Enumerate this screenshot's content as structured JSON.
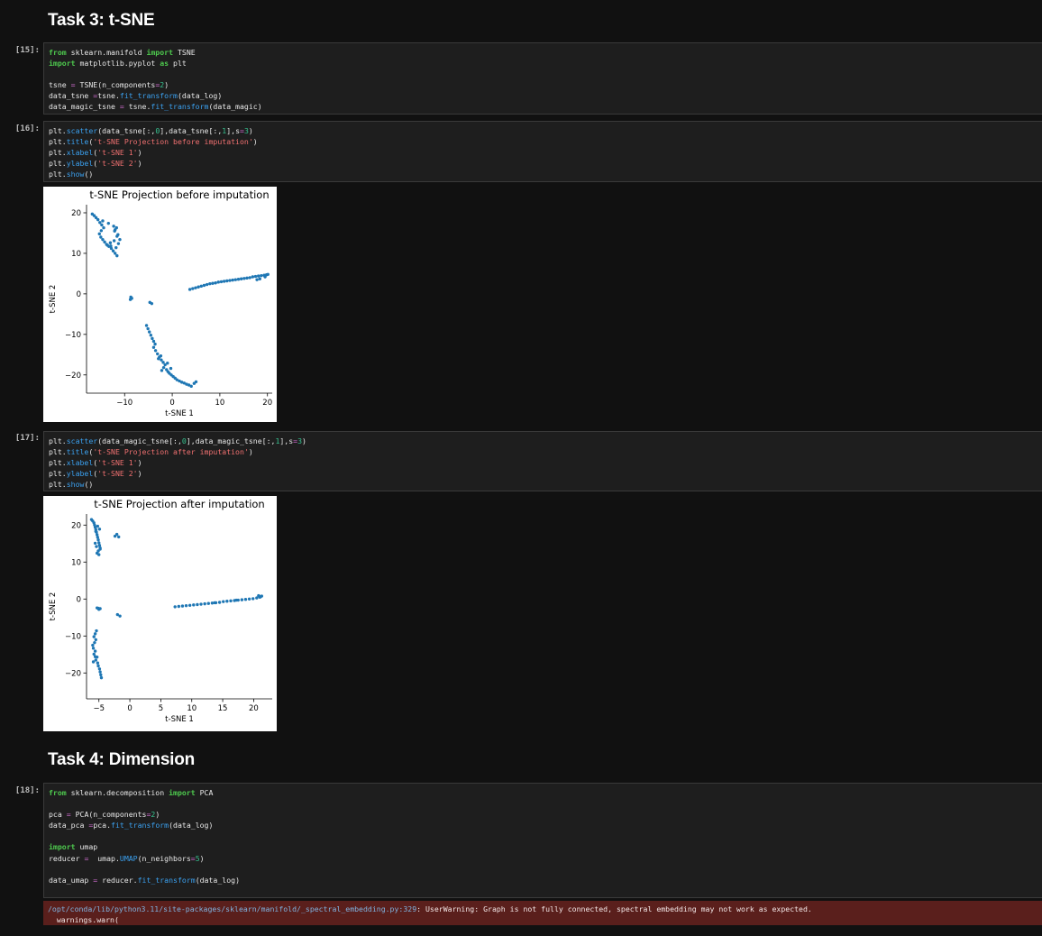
{
  "headings": {
    "task3": "Task 3: t-SNE",
    "task4": "Task 4: Dimension"
  },
  "cells": {
    "c15": {
      "prompt": "[15]:",
      "lines": [
        [
          [
            "kw",
            "from"
          ],
          [
            "t",
            " sklearn.manifold "
          ],
          [
            "kw",
            "import"
          ],
          [
            "t",
            " TSNE"
          ]
        ],
        [
          [
            "kw",
            "import"
          ],
          [
            "t",
            " matplotlib.pyplot "
          ],
          [
            "kw",
            "as"
          ],
          [
            "t",
            " plt"
          ]
        ],
        [],
        [
          [
            "t",
            "tsne "
          ],
          [
            "op",
            "="
          ],
          [
            "t",
            " TSNE(n_components"
          ],
          [
            "op",
            "="
          ],
          [
            "num",
            "2"
          ],
          [
            "t",
            ")"
          ]
        ],
        [
          [
            "t",
            "data_tsne "
          ],
          [
            "op",
            "="
          ],
          [
            "t",
            "tsne."
          ],
          [
            "fn",
            "fit_transform"
          ],
          [
            "t",
            "(data_log)"
          ]
        ],
        [
          [
            "t",
            "data_magic_tsne "
          ],
          [
            "op",
            "="
          ],
          [
            "t",
            " tsne."
          ],
          [
            "fn",
            "fit_transform"
          ],
          [
            "t",
            "(data_magic)"
          ]
        ]
      ]
    },
    "c16": {
      "prompt": "[16]:",
      "lines": [
        [
          [
            "t",
            "plt."
          ],
          [
            "fn",
            "scatter"
          ],
          [
            "t",
            "(data_tsne[:,"
          ],
          [
            "num",
            "0"
          ],
          [
            "t",
            "],data_tsne[:,"
          ],
          [
            "num",
            "1"
          ],
          [
            "t",
            "],s"
          ],
          [
            "op",
            "="
          ],
          [
            "num",
            "3"
          ],
          [
            "t",
            ")"
          ]
        ],
        [
          [
            "t",
            "plt."
          ],
          [
            "fn",
            "title"
          ],
          [
            "t",
            "("
          ],
          [
            "str",
            "'t-SNE Projection before imputation'"
          ],
          [
            "t",
            ")"
          ]
        ],
        [
          [
            "t",
            "plt."
          ],
          [
            "fn",
            "xlabel"
          ],
          [
            "t",
            "("
          ],
          [
            "str",
            "'t-SNE 1'"
          ],
          [
            "t",
            ")"
          ]
        ],
        [
          [
            "t",
            "plt."
          ],
          [
            "fn",
            "ylabel"
          ],
          [
            "t",
            "("
          ],
          [
            "str",
            "'t-SNE 2'"
          ],
          [
            "t",
            ")"
          ]
        ],
        [
          [
            "t",
            "plt."
          ],
          [
            "fn",
            "show"
          ],
          [
            "t",
            "()"
          ]
        ]
      ]
    },
    "c17": {
      "prompt": "[17]:",
      "lines": [
        [
          [
            "t",
            "plt."
          ],
          [
            "fn",
            "scatter"
          ],
          [
            "t",
            "(data_magic_tsne[:,"
          ],
          [
            "num",
            "0"
          ],
          [
            "t",
            "],data_magic_tsne[:,"
          ],
          [
            "num",
            "1"
          ],
          [
            "t",
            "],s"
          ],
          [
            "op",
            "="
          ],
          [
            "num",
            "3"
          ],
          [
            "t",
            ")"
          ]
        ],
        [
          [
            "t",
            "plt."
          ],
          [
            "fn",
            "title"
          ],
          [
            "t",
            "("
          ],
          [
            "str",
            "'t-SNE Projection after imputation'"
          ],
          [
            "t",
            ")"
          ]
        ],
        [
          [
            "t",
            "plt."
          ],
          [
            "fn",
            "xlabel"
          ],
          [
            "t",
            "("
          ],
          [
            "str",
            "'t-SNE 1'"
          ],
          [
            "t",
            ")"
          ]
        ],
        [
          [
            "t",
            "plt."
          ],
          [
            "fn",
            "ylabel"
          ],
          [
            "t",
            "("
          ],
          [
            "str",
            "'t-SNE 2'"
          ],
          [
            "t",
            ")"
          ]
        ],
        [
          [
            "t",
            "plt."
          ],
          [
            "fn",
            "show"
          ],
          [
            "t",
            "()"
          ]
        ]
      ]
    },
    "c18": {
      "prompt": "[18]:",
      "lines": [
        [
          [
            "kw",
            "from"
          ],
          [
            "t",
            " sklearn.decomposition "
          ],
          [
            "kw",
            "import"
          ],
          [
            "t",
            " PCA"
          ]
        ],
        [],
        [
          [
            "t",
            "pca "
          ],
          [
            "op",
            "="
          ],
          [
            "t",
            " PCA(n_components"
          ],
          [
            "op",
            "="
          ],
          [
            "num",
            "2"
          ],
          [
            "t",
            ")"
          ]
        ],
        [
          [
            "t",
            "data_pca "
          ],
          [
            "op",
            "="
          ],
          [
            "t",
            "pca."
          ],
          [
            "fn",
            "fit_transform"
          ],
          [
            "t",
            "(data_log)"
          ]
        ],
        [],
        [
          [
            "kw",
            "import"
          ],
          [
            "t",
            " umap"
          ]
        ],
        [
          [
            "t",
            "reducer "
          ],
          [
            "op",
            "="
          ],
          [
            "t",
            "  umap."
          ],
          [
            "fn",
            "UMAP"
          ],
          [
            "t",
            "(n_neighbors"
          ],
          [
            "op",
            "="
          ],
          [
            "num",
            "5"
          ],
          [
            "t",
            ")"
          ]
        ],
        [],
        [
          [
            "t",
            "data_umap "
          ],
          [
            "op",
            "="
          ],
          [
            "t",
            " reducer."
          ],
          [
            "fn",
            "fit_transform"
          ],
          [
            "t",
            "(data_log)"
          ]
        ]
      ]
    }
  },
  "stderr": {
    "path": "/opt/conda/lib/python3.11/site-packages/sklearn/manifold/_spectral_embedding.py:329",
    "message": ": UserWarning: Graph is not fully connected, spectral embedding may not work as expected.",
    "line2": "  warnings.warn("
  },
  "chart_data": [
    {
      "type": "scatter",
      "title": "t-SNE Projection before imputation",
      "xlabel": "t-SNE 1",
      "ylabel": "t-SNE 2",
      "xlim": [
        -18,
        21
      ],
      "ylim": [
        -24.5,
        22
      ],
      "xticks": [
        -10,
        0,
        10,
        20
      ],
      "yticks": [
        20,
        10,
        0,
        -10,
        -20
      ],
      "color": "#1f77b4",
      "series": [
        {
          "x": [
            -16.8,
            -16.4,
            -16.0,
            -15.6,
            -15.2,
            -14.8,
            -14.4,
            -14.9,
            -15.3,
            -15.0,
            -14.6,
            -14.2,
            -13.8,
            -13.3,
            -12.8,
            -12.4,
            -12.0,
            -11.6,
            -11.8,
            -11.3,
            -11.0,
            -11.4,
            -12.0,
            -12.3,
            -13.4,
            -14.6,
            -11.7,
            -12.1,
            -11.6,
            -12.2,
            -13.0,
            -13.6,
            -12.9,
            -8.7,
            -8.5,
            -8.8,
            -4.7,
            -4.3,
            3.7,
            4.3,
            4.9,
            5.5,
            6.1,
            6.7,
            7.3,
            7.9,
            8.5,
            9.1,
            9.7,
            10.3,
            10.9,
            11.5,
            12.1,
            12.7,
            13.3,
            13.9,
            14.5,
            15.1,
            15.7,
            16.3,
            16.9,
            17.5,
            18.1,
            18.7,
            19.3,
            19.8,
            20.1,
            19.5,
            18.4,
            17.8,
            -5.4,
            -5.1,
            -4.8,
            -4.5,
            -4.2,
            -3.9,
            -3.6,
            -3.9,
            -3.5,
            -3.1,
            -2.7,
            -2.3,
            -1.9,
            -1.5,
            -1.8,
            -2.2,
            -1.2,
            -0.9,
            -0.6,
            -0.2,
            0.2,
            0.6,
            1.0,
            1.5,
            2.0,
            2.5,
            3.0,
            3.5,
            4.0,
            4.6,
            5.0,
            -2.4,
            -2.9,
            -1.0,
            -0.3
          ],
          "y": [
            19.7,
            19.3,
            18.8,
            18.3,
            17.6,
            17.0,
            16.3,
            15.6,
            14.8,
            14.0,
            13.4,
            12.8,
            12.2,
            11.7,
            11.2,
            10.6,
            10.0,
            9.4,
            11.4,
            12.4,
            13.4,
            14.6,
            15.8,
            16.7,
            17.4,
            18.0,
            16.3,
            15.5,
            14.2,
            13.1,
            12.6,
            12.0,
            11.8,
            -0.8,
            -1.1,
            -1.4,
            -2.1,
            -2.4,
            1.1,
            1.3,
            1.5,
            1.7,
            1.9,
            2.1,
            2.3,
            2.5,
            2.6,
            2.7,
            2.9,
            3.0,
            3.1,
            3.2,
            3.3,
            3.4,
            3.5,
            3.6,
            3.7,
            3.8,
            3.9,
            4.0,
            4.2,
            4.3,
            4.4,
            4.5,
            4.6,
            4.7,
            4.8,
            4.2,
            3.7,
            3.5,
            -7.8,
            -8.6,
            -9.4,
            -10.2,
            -11.0,
            -11.7,
            -12.4,
            -13.2,
            -14.0,
            -14.8,
            -15.6,
            -16.3,
            -16.9,
            -17.5,
            -18.2,
            -18.9,
            -18.7,
            -19.2,
            -19.6,
            -20.0,
            -20.4,
            -20.8,
            -21.2,
            -21.5,
            -21.8,
            -22.0,
            -22.3,
            -22.5,
            -22.8,
            -22.1,
            -21.7,
            -15.3,
            -16.0,
            -17.1,
            -18.4
          ]
        }
      ]
    },
    {
      "type": "scatter",
      "title": "t-SNE Projection after imputation",
      "xlabel": "t-SNE 1",
      "ylabel": "t-SNE 2",
      "xlim": [
        -7,
        23
      ],
      "ylim": [
        -27,
        23
      ],
      "xticks": [
        -5,
        0,
        5,
        10,
        15,
        20
      ],
      "yticks": [
        20,
        10,
        0,
        -10,
        -20
      ],
      "color": "#1f77b4",
      "series": [
        {
          "x": [
            -6.2,
            -6.0,
            -5.8,
            -5.7,
            -5.6,
            -5.5,
            -5.4,
            -5.3,
            -5.2,
            -5.1,
            -5.0,
            -4.9,
            -4.8,
            -5.1,
            -5.3,
            -5.0,
            -4.8,
            -5.4,
            -5.6,
            -5.5,
            -5.2,
            -4.9,
            -2.1,
            -2.4,
            -1.8,
            -5.1,
            -5.0,
            -4.8,
            -5.3,
            -2.0,
            -1.6,
            -5.4,
            -5.6,
            -5.8,
            -5.5,
            -5.7,
            -6.0,
            -5.9,
            -5.6,
            -5.8,
            -5.3,
            -5.5,
            -5.2,
            -5.1,
            -4.9,
            -4.8,
            -4.7,
            -4.6,
            -5.9,
            -5.6,
            7.3,
            7.9,
            8.5,
            9.1,
            9.7,
            10.3,
            10.9,
            11.5,
            12.1,
            12.7,
            13.3,
            13.9,
            14.5,
            15.1,
            15.7,
            16.3,
            16.9,
            17.5,
            18.1,
            18.7,
            19.3,
            19.9,
            20.5,
            21.0,
            21.3,
            20.8,
            21.1,
            17.2,
            13.7
          ],
          "y": [
            21.5,
            21.1,
            20.6,
            20.0,
            19.4,
            18.8,
            18.1,
            17.4,
            16.7,
            16.0,
            15.2,
            14.5,
            13.8,
            13.0,
            12.4,
            12.0,
            13.5,
            14.2,
            15.1,
            18.3,
            19.7,
            18.9,
            17.5,
            17.0,
            16.8,
            -2.5,
            -2.8,
            -2.6,
            -2.4,
            -4.2,
            -4.6,
            -8.6,
            -9.4,
            -10.2,
            -11.0,
            -11.8,
            -12.5,
            -13.3,
            -14.1,
            -14.9,
            -15.7,
            -16.5,
            -17.3,
            -18.1,
            -18.9,
            -19.7,
            -20.5,
            -21.3,
            -17.0,
            -15.6,
            -2.1,
            -2.0,
            -1.9,
            -1.8,
            -1.7,
            -1.6,
            -1.5,
            -1.4,
            -1.3,
            -1.2,
            -1.1,
            -1.0,
            -0.9,
            -0.7,
            -0.6,
            -0.5,
            -0.4,
            -0.3,
            -0.2,
            -0.1,
            0.0,
            0.1,
            0.3,
            0.5,
            0.8,
            0.9,
            0.6,
            -0.3,
            -1.0
          ]
        }
      ]
    }
  ]
}
